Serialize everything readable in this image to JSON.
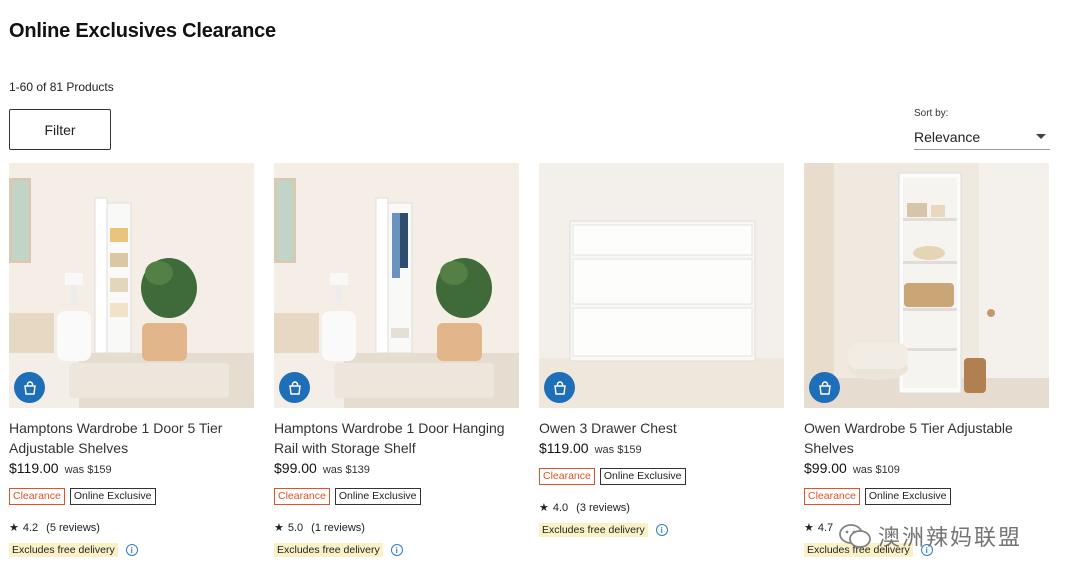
{
  "page": {
    "title": "Online Exclusives Clearance",
    "count": "1-60 of 81 Products"
  },
  "toolbar": {
    "filter_label": "Filter",
    "sort_label": "Sort by:",
    "sort_value": "Relevance"
  },
  "colors": {
    "accent": "#1f6fb8",
    "clearance": "#d9532b",
    "delivery_bg": "#fbf1c7"
  },
  "products": [
    {
      "title": "Hamptons Wardrobe 1 Door 5 Tier Adjustable Shelves",
      "price": "$119.00",
      "was": "was $159",
      "badge_clearance": "Clearance",
      "badge_online": "Online Exclusive",
      "rating": "4.2",
      "reviews": "(5 reviews)",
      "delivery": "Excludes free delivery"
    },
    {
      "title": "Hamptons Wardrobe 1 Door Hanging Rail with Storage Shelf",
      "price": "$99.00",
      "was": "was $139",
      "badge_clearance": "Clearance",
      "badge_online": "Online Exclusive",
      "rating": "5.0",
      "reviews": "(1 reviews)",
      "delivery": "Excludes free delivery"
    },
    {
      "title": "Owen 3 Drawer Chest",
      "price": "$119.00",
      "was": "was $159",
      "badge_clearance": "Clearance",
      "badge_online": "Online Exclusive",
      "rating": "4.0",
      "reviews": "(3 reviews)",
      "delivery": "Excludes free delivery"
    },
    {
      "title": "Owen Wardrobe 5 Tier Adjustable Shelves",
      "price": "$99.00",
      "was": "was $109",
      "badge_clearance": "Clearance",
      "badge_online": "Online Exclusive",
      "rating": "4.7",
      "reviews": "",
      "delivery": "Excludes free delivery"
    }
  ],
  "watermark": {
    "text": "澳洲辣妈联盟"
  }
}
